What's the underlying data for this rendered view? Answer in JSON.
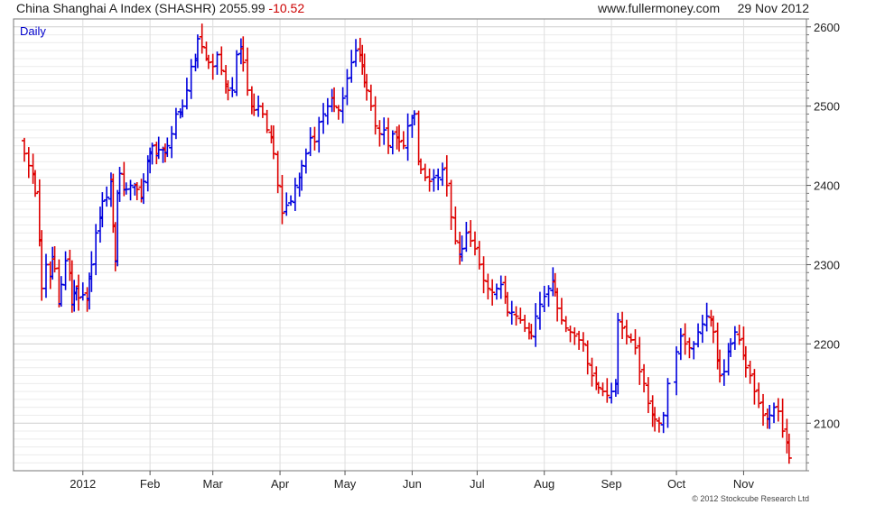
{
  "header": {
    "name": "China Shanghai A Index (SHASHR)",
    "last": "2055.99",
    "change": "-10.52",
    "site": "www.fullermoney.com",
    "date": "29 Nov 2012"
  },
  "timeframe_label": "Daily",
  "copyright": "© 2012 Stockcube Research Ltd",
  "colors": {
    "up": "#0000dd",
    "down": "#dd0000",
    "grid": "#d8d8d8",
    "axis": "#555555"
  },
  "chart_data": {
    "type": "ohlc",
    "title": "China Shanghai A Index (SHASHR)",
    "ylim": [
      2040,
      2610
    ],
    "yticks": [
      2100,
      2200,
      2300,
      2400,
      2500,
      2600
    ],
    "grid": true,
    "xrange_days": [
      0,
      366
    ],
    "x_ticks": [
      {
        "label": "2012",
        "day": 32
      },
      {
        "label": "Feb",
        "day": 63
      },
      {
        "label": "Mar",
        "day": 92
      },
      {
        "label": "Apr",
        "day": 123
      },
      {
        "label": "May",
        "day": 153
      },
      {
        "label": "Jun",
        "day": 184
      },
      {
        "label": "Jul",
        "day": 214
      },
      {
        "label": "Aug",
        "day": 245
      },
      {
        "label": "Sep",
        "day": 276
      },
      {
        "label": "Oct",
        "day": 306
      },
      {
        "label": "Nov",
        "day": 337
      }
    ],
    "closes": [
      [
        3,
        2455
      ],
      [
        5,
        2440
      ],
      [
        7,
        2425
      ],
      [
        9,
        2415
      ],
      [
        10,
        2390
      ],
      [
        12,
        2330
      ],
      [
        13,
        2270
      ],
      [
        15,
        2300
      ],
      [
        17,
        2285
      ],
      [
        18,
        2310
      ],
      [
        19,
        2295
      ],
      [
        21,
        2250
      ],
      [
        22,
        2275
      ],
      [
        24,
        2305
      ],
      [
        26,
        2290
      ],
      [
        27,
        2250
      ],
      [
        28,
        2265
      ],
      [
        29,
        2270
      ],
      [
        30,
        2258
      ],
      [
        32,
        2262
      ],
      [
        34,
        2255
      ],
      [
        35,
        2285
      ],
      [
        36,
        2300
      ],
      [
        38,
        2340
      ],
      [
        40,
        2360
      ],
      [
        41,
        2380
      ],
      [
        43,
        2385
      ],
      [
        45,
        2405
      ],
      [
        46,
        2350
      ],
      [
        47,
        2305
      ],
      [
        48,
        2390
      ],
      [
        49,
        2415
      ],
      [
        51,
        2395
      ],
      [
        52,
        2395
      ],
      [
        54,
        2400
      ],
      [
        56,
        2400
      ],
      [
        57,
        2395
      ],
      [
        59,
        2385
      ],
      [
        60,
        2405
      ],
      [
        62,
        2430
      ],
      [
        63,
        2440
      ],
      [
        64,
        2450
      ],
      [
        66,
        2440
      ],
      [
        67,
        2445
      ],
      [
        69,
        2445
      ],
      [
        70,
        2440
      ],
      [
        71,
        2450
      ],
      [
        73,
        2465
      ],
      [
        75,
        2490
      ],
      [
        77,
        2490
      ],
      [
        78,
        2500
      ],
      [
        80,
        2520
      ],
      [
        82,
        2550
      ],
      [
        84,
        2560
      ],
      [
        85,
        2585
      ],
      [
        87,
        2575
      ],
      [
        89,
        2560
      ],
      [
        90,
        2555
      ],
      [
        92,
        2550
      ],
      [
        94,
        2565
      ],
      [
        96,
        2545
      ],
      [
        98,
        2525
      ],
      [
        99,
        2520
      ],
      [
        101,
        2520
      ],
      [
        103,
        2565
      ],
      [
        105,
        2575
      ],
      [
        106,
        2555
      ],
      [
        108,
        2520
      ],
      [
        110,
        2500
      ],
      [
        111,
        2495
      ],
      [
        113,
        2500
      ],
      [
        115,
        2490
      ],
      [
        117,
        2470
      ],
      [
        119,
        2460
      ],
      [
        120,
        2440
      ],
      [
        122,
        2400
      ],
      [
        124,
        2365
      ],
      [
        126,
        2375
      ],
      [
        128,
        2380
      ],
      [
        130,
        2400
      ],
      [
        132,
        2410
      ],
      [
        133,
        2425
      ],
      [
        135,
        2440
      ],
      [
        137,
        2460
      ],
      [
        139,
        2455
      ],
      [
        141,
        2480
      ],
      [
        143,
        2490
      ],
      [
        145,
        2500
      ],
      [
        147,
        2510
      ],
      [
        148,
        2500
      ],
      [
        150,
        2495
      ],
      [
        152,
        2510
      ],
      [
        154,
        2535
      ],
      [
        156,
        2555
      ],
      [
        158,
        2570
      ],
      [
        160,
        2565
      ],
      [
        161,
        2550
      ],
      [
        162,
        2530
      ],
      [
        163,
        2520
      ],
      [
        165,
        2500
      ],
      [
        167,
        2475
      ],
      [
        169,
        2465
      ],
      [
        171,
        2470
      ],
      [
        173,
        2450
      ],
      [
        175,
        2465
      ],
      [
        177,
        2460
      ],
      [
        178,
        2455
      ],
      [
        180,
        2450
      ],
      [
        182,
        2475
      ],
      [
        184,
        2485
      ],
      [
        185,
        2490
      ],
      [
        187,
        2430
      ],
      [
        188,
        2420
      ],
      [
        190,
        2410
      ],
      [
        192,
        2405
      ],
      [
        194,
        2410
      ],
      [
        196,
        2410
      ],
      [
        198,
        2420
      ],
      [
        200,
        2400
      ],
      [
        202,
        2360
      ],
      [
        204,
        2330
      ],
      [
        206,
        2310
      ],
      [
        207,
        2320
      ],
      [
        209,
        2340
      ],
      [
        211,
        2330
      ],
      [
        213,
        2320
      ],
      [
        215,
        2300
      ],
      [
        217,
        2280
      ],
      [
        219,
        2270
      ],
      [
        221,
        2265
      ],
      [
        223,
        2270
      ],
      [
        225,
        2275
      ],
      [
        227,
        2260
      ],
      [
        228,
        2240
      ],
      [
        230,
        2240
      ],
      [
        232,
        2235
      ],
      [
        234,
        2230
      ],
      [
        236,
        2220
      ],
      [
        238,
        2215
      ],
      [
        239,
        2210
      ],
      [
        241,
        2235
      ],
      [
        243,
        2250
      ],
      [
        245,
        2260
      ],
      [
        247,
        2270
      ],
      [
        249,
        2280
      ],
      [
        250,
        2265
      ],
      [
        251,
        2245
      ],
      [
        253,
        2230
      ],
      [
        255,
        2220
      ],
      [
        257,
        2215
      ],
      [
        259,
        2210
      ],
      [
        261,
        2205
      ],
      [
        263,
        2200
      ],
      [
        265,
        2175
      ],
      [
        267,
        2160
      ],
      [
        269,
        2150
      ],
      [
        270,
        2145
      ],
      [
        272,
        2140
      ],
      [
        274,
        2135
      ],
      [
        276,
        2140
      ],
      [
        278,
        2150
      ],
      [
        279,
        2230
      ],
      [
        281,
        2220
      ],
      [
        283,
        2210
      ],
      [
        285,
        2205
      ],
      [
        287,
        2195
      ],
      [
        289,
        2165
      ],
      [
        291,
        2150
      ],
      [
        293,
        2125
      ],
      [
        295,
        2110
      ],
      [
        296,
        2105
      ],
      [
        298,
        2100
      ],
      [
        300,
        2110
      ],
      [
        302,
        2150
      ],
      [
        306,
        2190
      ],
      [
        308,
        2210
      ],
      [
        310,
        2200
      ],
      [
        312,
        2195
      ],
      [
        314,
        2200
      ],
      [
        316,
        2215
      ],
      [
        318,
        2225
      ],
      [
        320,
        2235
      ],
      [
        322,
        2230
      ],
      [
        323,
        2215
      ],
      [
        325,
        2180
      ],
      [
        326,
        2160
      ],
      [
        328,
        2165
      ],
      [
        330,
        2190
      ],
      [
        331,
        2200
      ],
      [
        333,
        2215
      ],
      [
        335,
        2205
      ],
      [
        337,
        2185
      ],
      [
        338,
        2170
      ],
      [
        340,
        2160
      ],
      [
        342,
        2140
      ],
      [
        344,
        2125
      ],
      [
        346,
        2110
      ],
      [
        348,
        2105
      ],
      [
        349,
        2110
      ],
      [
        351,
        2120
      ],
      [
        353,
        2115
      ],
      [
        355,
        2090
      ],
      [
        357,
        2075
      ],
      [
        358,
        2056
      ]
    ]
  }
}
